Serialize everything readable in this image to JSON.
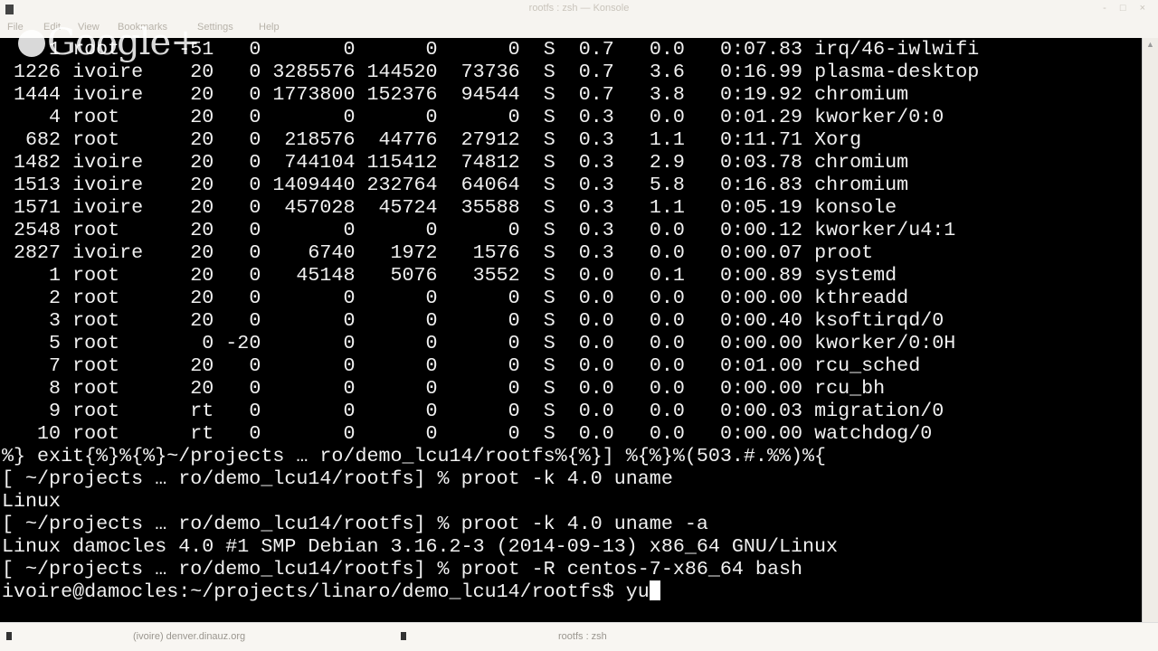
{
  "window": {
    "title": "rootfs : zsh — Konsole",
    "buttons": "- □ ×"
  },
  "menu": [
    "File",
    "Edit",
    "View",
    "Bookmarks",
    "Settings",
    "Help"
  ],
  "watermark": "Google+",
  "processes": [
    [
      "1",
      "root",
      "-51",
      "0",
      "0",
      "0",
      "0",
      "S",
      "0.7",
      "0.0",
      "0:07.83",
      "irq/46-iwlwifi"
    ],
    [
      "1226",
      "ivoire",
      "20",
      "0",
      "3285576",
      "144520",
      "73736",
      "S",
      "0.7",
      "3.6",
      "0:16.99",
      "plasma-desktop"
    ],
    [
      "1444",
      "ivoire",
      "20",
      "0",
      "1773800",
      "152376",
      "94544",
      "S",
      "0.7",
      "3.8",
      "0:19.92",
      "chromium"
    ],
    [
      "4",
      "root",
      "20",
      "0",
      "0",
      "0",
      "0",
      "S",
      "0.3",
      "0.0",
      "0:01.29",
      "kworker/0:0"
    ],
    [
      "682",
      "root",
      "20",
      "0",
      "218576",
      "44776",
      "27912",
      "S",
      "0.3",
      "1.1",
      "0:11.71",
      "Xorg"
    ],
    [
      "1482",
      "ivoire",
      "20",
      "0",
      "744104",
      "115412",
      "74812",
      "S",
      "0.3",
      "2.9",
      "0:03.78",
      "chromium"
    ],
    [
      "1513",
      "ivoire",
      "20",
      "0",
      "1409440",
      "232764",
      "64064",
      "S",
      "0.3",
      "5.8",
      "0:16.83",
      "chromium"
    ],
    [
      "1571",
      "ivoire",
      "20",
      "0",
      "457028",
      "45724",
      "35588",
      "S",
      "0.3",
      "1.1",
      "0:05.19",
      "konsole"
    ],
    [
      "2548",
      "root",
      "20",
      "0",
      "0",
      "0",
      "0",
      "S",
      "0.3",
      "0.0",
      "0:00.12",
      "kworker/u4:1"
    ],
    [
      "2827",
      "ivoire",
      "20",
      "0",
      "6740",
      "1972",
      "1576",
      "S",
      "0.3",
      "0.0",
      "0:00.07",
      "proot"
    ],
    [
      "1",
      "root",
      "20",
      "0",
      "45148",
      "5076",
      "3552",
      "S",
      "0.0",
      "0.1",
      "0:00.89",
      "systemd"
    ],
    [
      "2",
      "root",
      "20",
      "0",
      "0",
      "0",
      "0",
      "S",
      "0.0",
      "0.0",
      "0:00.00",
      "kthreadd"
    ],
    [
      "3",
      "root",
      "20",
      "0",
      "0",
      "0",
      "0",
      "S",
      "0.0",
      "0.0",
      "0:00.40",
      "ksoftirqd/0"
    ],
    [
      "5",
      "root",
      "0",
      "-20",
      "0",
      "0",
      "0",
      "S",
      "0.0",
      "0.0",
      "0:00.00",
      "kworker/0:0H"
    ],
    [
      "7",
      "root",
      "20",
      "0",
      "0",
      "0",
      "0",
      "S",
      "0.0",
      "0.0",
      "0:01.00",
      "rcu_sched"
    ],
    [
      "8",
      "root",
      "20",
      "0",
      "0",
      "0",
      "0",
      "S",
      "0.0",
      "0.0",
      "0:00.00",
      "rcu_bh"
    ],
    [
      "9",
      "root",
      "rt",
      "0",
      "0",
      "0",
      "0",
      "S",
      "0.0",
      "0.0",
      "0:00.03",
      "migration/0"
    ],
    [
      "10",
      "root",
      "rt",
      "0",
      "0",
      "0",
      "0",
      "S",
      "0.0",
      "0.0",
      "0:00.00",
      "watchdog/0"
    ]
  ],
  "shell_lines": [
    "%} exit{%}%{%}~/projects … ro/demo_lcu14/rootfs%{%}] %{%}%(503.#.%%)%{",
    "[ ~/projects … ro/demo_lcu14/rootfs] % proot -k 4.0 uname",
    "Linux",
    "[ ~/projects … ro/demo_lcu14/rootfs] % proot -k 4.0 uname -a",
    "Linux damocles 4.0 #1 SMP Debian 3.16.2-3 (2014-09-13) x86_64 GNU/Linux",
    "[ ~/projects … ro/demo_lcu14/rootfs] % proot -R centos-7-x86_64 bash"
  ],
  "prompt": "ivoire@damocles:~/projects/linaro/demo_lcu14/rootfs$ ",
  "input": "yu",
  "taskbar": [
    "(ivoire) denver.dinauz.org",
    "rootfs : zsh"
  ]
}
